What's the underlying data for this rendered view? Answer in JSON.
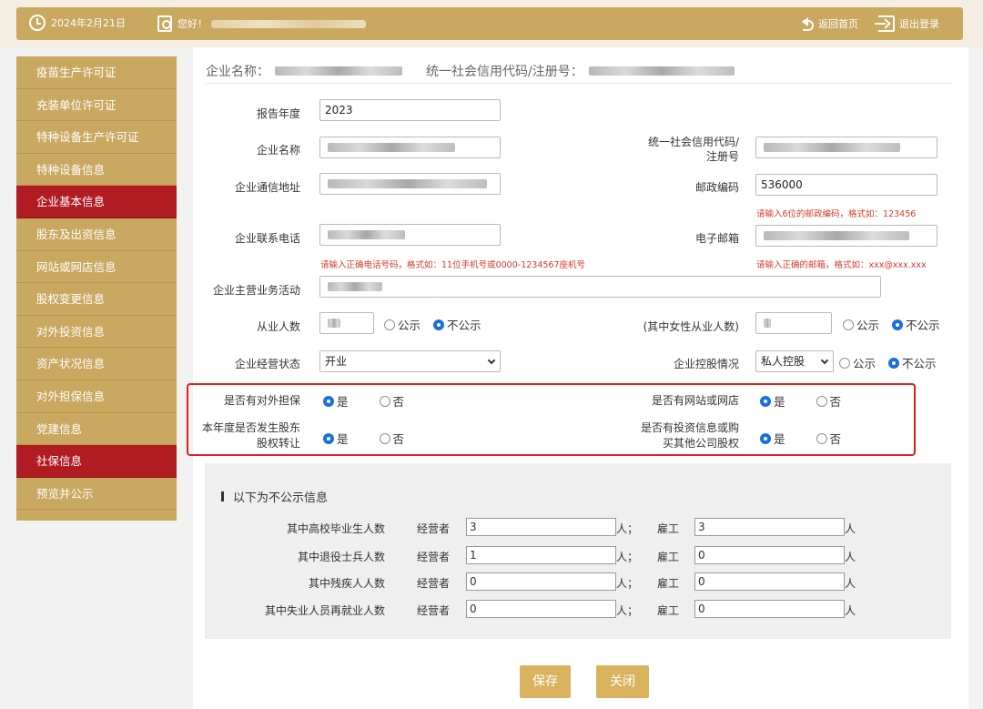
{
  "topbar": {
    "date": "2024年2月21日",
    "greeting": "您好！",
    "back_home": "返回首页",
    "logout": "退出登录"
  },
  "sidebar": {
    "items": [
      {
        "label": "疫苗生产许可证",
        "active": false
      },
      {
        "label": "充装单位许可证",
        "active": false
      },
      {
        "label": "特种设备生产许可证",
        "active": false
      },
      {
        "label": "特种设备信息",
        "active": false
      },
      {
        "label": "企业基本信息",
        "active": true
      },
      {
        "label": "股东及出资信息",
        "active": false
      },
      {
        "label": "网站或网店信息",
        "active": false
      },
      {
        "label": "股权变更信息",
        "active": false
      },
      {
        "label": "对外投资信息",
        "active": false
      },
      {
        "label": "资产状况信息",
        "active": false
      },
      {
        "label": "对外担保信息",
        "active": false
      },
      {
        "label": "党建信息",
        "active": false
      },
      {
        "label": "社保信息",
        "active": true
      },
      {
        "label": "预览并公示",
        "active": false
      }
    ]
  },
  "header": {
    "company_name_label": "企业名称：",
    "credit_code_label": "统一社会信用代码/注册号："
  },
  "form": {
    "report_year_label": "报告年度",
    "report_year": "2023",
    "company_name_label": "企业名称",
    "credit_code_label_1": "统一社会信用代码/",
    "credit_code_label_2": "注册号",
    "address_label": "企业通信地址",
    "postcode_label": "邮政编码",
    "postcode": "536000",
    "postcode_hint": "请输入6位的邮政编码，格式如：123456",
    "phone_label": "企业联系电话",
    "phone_hint": "请输入正确电话号码，格式如：11位手机号或0000-1234567座机号",
    "email_label": "电子邮箱",
    "email_hint": "请输入正确的邮箱，格式如：xxx@xxx.xxx",
    "business_label": "企业主营业务活动",
    "employees_label": "从业人数",
    "female_label": "(其中女性从业人数)",
    "public": "公示",
    "not_public": "不公示",
    "status_label": "企业经营状态",
    "status_value": "开业",
    "control_label": "企业控股情况",
    "control_value": "私人控股",
    "guarantee_label": "是否有对外担保",
    "website_label": "是否有网站或网店",
    "transfer_label_1": "本年度是否发生股东",
    "transfer_label_2": "股权转让",
    "invest_label_1": "是否有投资信息或购",
    "invest_label_2": "买其他公司股权",
    "yes": "是",
    "no": "否"
  },
  "private": {
    "title": "以下为不公示信息",
    "operator_label": "经营者",
    "employee_label": "雇工",
    "unit": "人；",
    "unit2": "人",
    "rows": [
      {
        "label": "其中高校毕业生人数",
        "operator": "3",
        "employee": "3"
      },
      {
        "label": "其中退役士兵人数",
        "operator": "1",
        "employee": "0"
      },
      {
        "label": "其中残疾人人数",
        "operator": "0",
        "employee": "0"
      },
      {
        "label": "其中失业人员再就业人数",
        "operator": "0",
        "employee": "0"
      }
    ]
  },
  "buttons": {
    "save": "保存",
    "close": "关闭"
  },
  "colors": {
    "gold": "#c9a85f",
    "active_red": "#b01c22",
    "hint_red": "#d43a2a",
    "radio_blue": "#1a6fe0"
  }
}
